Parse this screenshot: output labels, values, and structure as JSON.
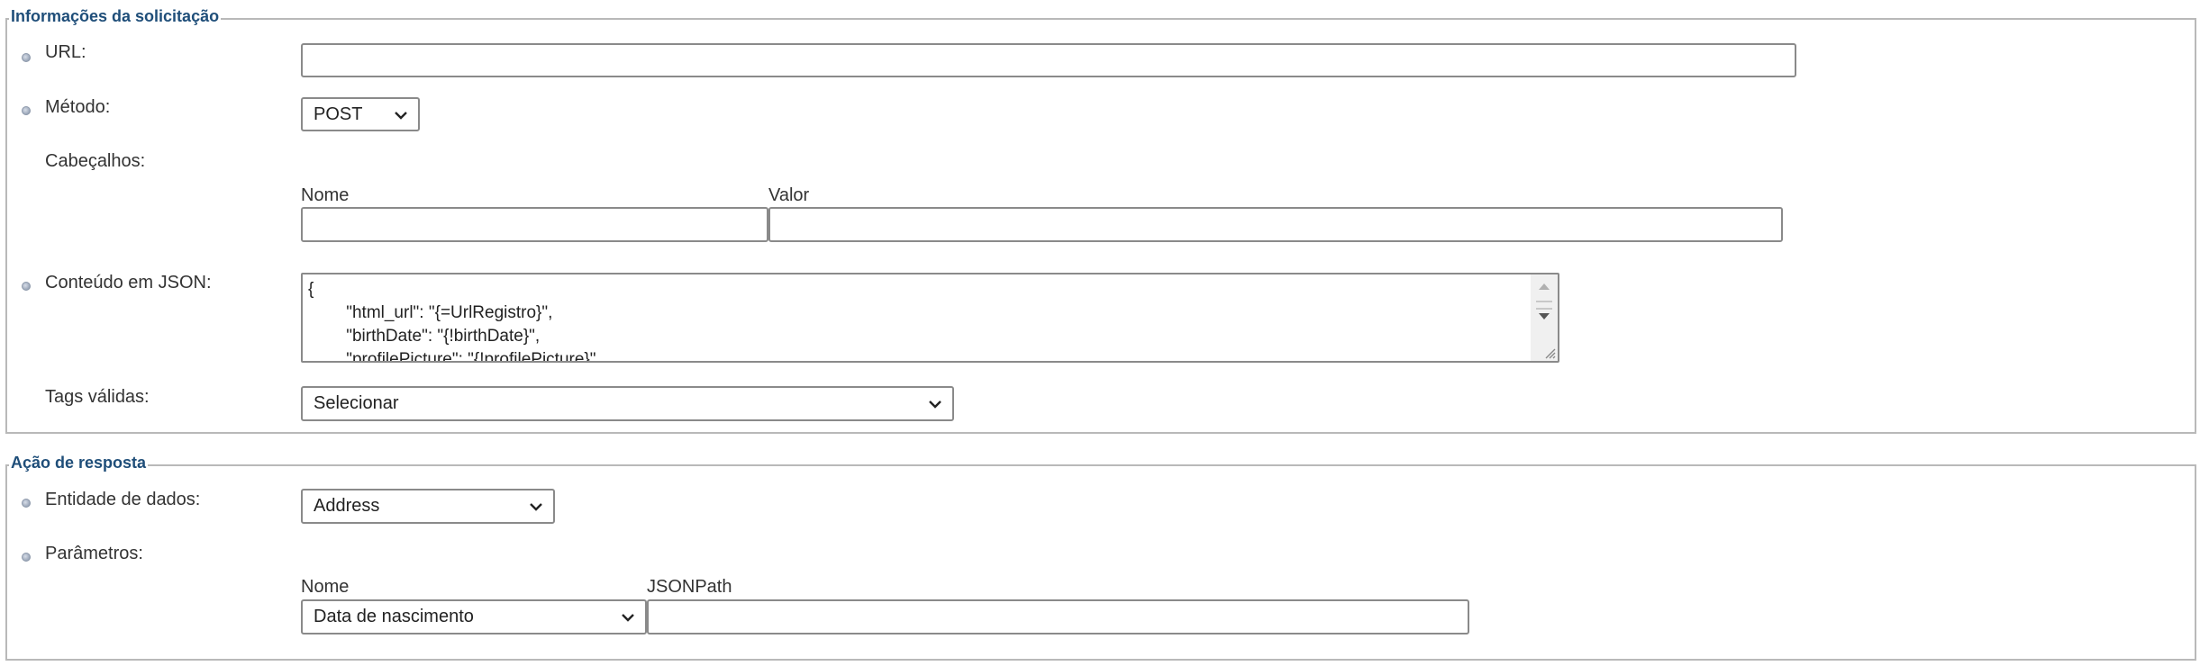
{
  "request_section": {
    "legend": "Informações da solicitação",
    "url": {
      "label": "URL:",
      "value": ""
    },
    "method": {
      "label": "Método:",
      "selected": "POST"
    },
    "headers": {
      "label": "Cabeçalhos:",
      "name_header": "Nome",
      "value_header": "Valor",
      "name_value": "",
      "value_value": ""
    },
    "json_content": {
      "label": "Conteúdo em JSON:",
      "lines": [
        "{",
        "        \"html_url\": \"{=UrlRegistro}\",",
        "        \"birthDate\": \"{!birthDate}\",",
        "        \"profilePicture\": \"{!profilePicture}\""
      ]
    },
    "valid_tags": {
      "label": "Tags válidas:",
      "selected": "Selecionar"
    }
  },
  "response_section": {
    "legend": "Ação de resposta",
    "data_entity": {
      "label": "Entidade de dados:",
      "selected": "Address"
    },
    "parameters": {
      "label": "Parâmetros:",
      "name_header": "Nome",
      "jsonpath_header": "JSONPath",
      "name_selected": "Data de nascimento",
      "jsonpath_value": ""
    }
  },
  "colors": {
    "legend_text": "#1f4e79",
    "border": "#b9b9b9",
    "field_border": "#8a8a8a"
  },
  "icons": [
    "bullet-icon",
    "chevron-down-icon",
    "scroll-up-arrow-icon",
    "scroll-down-arrow-icon",
    "resize-grip-icon"
  ]
}
